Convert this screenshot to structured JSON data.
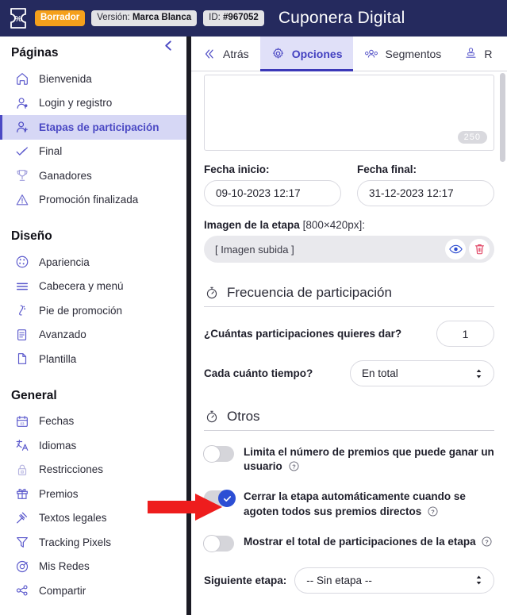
{
  "header": {
    "logo_icon": "coupon-percent-icon",
    "status_badge": "Borrador",
    "version_prefix": "Versión:",
    "version_value": "Marca Blanca",
    "id_prefix": "ID:",
    "id_value": "#967052",
    "title": "Cuponera Digital",
    "bg_color": "#252a5e",
    "badge_color": "#f5a01b"
  },
  "sidebar": {
    "collapse_icon": "chevron-left-icon",
    "groups": [
      {
        "title": "Páginas",
        "items": [
          {
            "label": "Bienvenida",
            "icon": "home-icon",
            "active": false
          },
          {
            "label": "Login y registro",
            "icon": "user-login-icon",
            "active": false
          },
          {
            "label": "Etapas de participación",
            "icon": "user-stage-icon",
            "active": true
          },
          {
            "label": "Final",
            "icon": "check-icon",
            "active": false
          },
          {
            "label": "Ganadores",
            "icon": "trophy-icon",
            "active": false
          },
          {
            "label": "Promoción finalizada",
            "icon": "warning-triangle-icon",
            "active": false
          }
        ]
      },
      {
        "title": "Diseño",
        "items": [
          {
            "label": "Apariencia",
            "icon": "palette-icon",
            "active": false
          },
          {
            "label": "Cabecera y menú",
            "icon": "menu-lines-icon",
            "active": false
          },
          {
            "label": "Pie de promoción",
            "icon": "footer-icon",
            "active": false
          },
          {
            "label": "Avanzado",
            "icon": "scroll-document-icon",
            "active": false
          },
          {
            "label": "Plantilla",
            "icon": "page-icon",
            "active": false
          }
        ]
      },
      {
        "title": "General",
        "items": [
          {
            "label": "Fechas",
            "icon": "calendar-icon",
            "active": false
          },
          {
            "label": "Idiomas",
            "icon": "translate-icon",
            "active": false
          },
          {
            "label": "Restricciones",
            "icon": "lock-icon",
            "active": false
          },
          {
            "label": "Premios",
            "icon": "gift-icon",
            "active": false
          },
          {
            "label": "Textos legales",
            "icon": "gavel-icon",
            "active": false
          },
          {
            "label": "Tracking Pixels",
            "icon": "funnel-icon",
            "active": false
          },
          {
            "label": "Mis Redes",
            "icon": "network-globe-icon",
            "active": false
          },
          {
            "label": "Compartir",
            "icon": "share-icon",
            "active": false
          }
        ]
      }
    ],
    "active_color": "#4b49c4",
    "active_bg": "#d6d7f5"
  },
  "panel": {
    "tabs": [
      {
        "label": "Atrás",
        "icon": "double-chevron-left-icon",
        "active": false
      },
      {
        "label": "Opciones",
        "icon": "gear-icon",
        "active": true
      },
      {
        "label": "Segmentos",
        "icon": "people-group-icon",
        "active": false
      },
      {
        "label": "R",
        "icon": "stamp-icon",
        "active": false
      }
    ],
    "textarea": {
      "value": "",
      "char_counter": "250"
    },
    "date_start": {
      "label": "Fecha inicio:",
      "value": "09-10-2023 12:17"
    },
    "date_end": {
      "label": "Fecha final:",
      "value": "31-12-2023 12:17"
    },
    "image_field": {
      "label": "Imagen de la etapa",
      "dimensions": "[800×420px]:",
      "value": "[ Imagen subida ]",
      "preview_icon": "eye-icon",
      "delete_icon": "trash-icon"
    },
    "frequency_section": {
      "icon": "stopwatch-icon",
      "title": "Frecuencia de participación",
      "count_label": "¿Cuántas participaciones quieres dar?",
      "count_value": "1",
      "period_label": "Cada cuánto tiempo?",
      "period_value": "En total"
    },
    "others_section": {
      "icon": "stopwatch-icon",
      "title": "Otros",
      "toggles": [
        {
          "label": "Limita el número de premios que puede ganar un usuario",
          "on": false,
          "help_icon": "question-circle-icon"
        },
        {
          "label": "Cerrar la etapa automáticamente cuando se agoten todos sus premios directos",
          "on": true,
          "help_icon": "question-circle-icon"
        },
        {
          "label": "Mostrar el total de participaciones de la etapa",
          "on": false,
          "help_icon": "question-circle-icon"
        }
      ],
      "next_stage_label": "Siguiente etapa:",
      "next_stage_value": "-- Sin etapa --"
    }
  },
  "annotation": {
    "arrow_color": "#ee1d1d",
    "arrow_icon": "red-pointer-arrow"
  }
}
